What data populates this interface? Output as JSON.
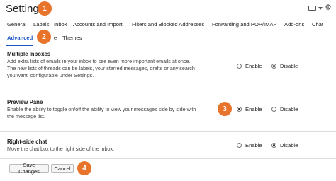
{
  "page": {
    "title": "Settings"
  },
  "annotations": [
    "1",
    "2",
    "3",
    "4"
  ],
  "tabs": {
    "row1": [
      "General",
      "Labels",
      "Inbox",
      "Accounts and Import",
      "Filters and Blocked Addresses",
      "Forwarding and POP/IMAP",
      "Add-ons",
      "Chat"
    ],
    "row2": {
      "active": "Advanced",
      "partial": "e",
      "other": "Themes"
    }
  },
  "sections": [
    {
      "title": "Multiple Inboxes",
      "description": [
        "Add extra lists of emails in your inbox to see even more important emails at once.",
        "The new lists of threads can be labels, your starred messages, drafts or any search",
        "you want, configurable under Settings."
      ],
      "enable_label": "Enable",
      "disable_label": "Disable",
      "selected": "Disable"
    },
    {
      "title": "Preview Pane",
      "description": [
        "Enable the ability to toggle on/off the ability to view your messages side by side with",
        "the message list."
      ],
      "enable_label": "Enable",
      "disable_label": "Disable",
      "selected": "Enable"
    },
    {
      "title": "Right-side chat",
      "description": [
        "Move the chat box to the right side of the inbox."
      ],
      "enable_label": "Enable",
      "disable_label": "Disable",
      "selected": "Disable"
    }
  ],
  "buttons": {
    "save": "Save Changes",
    "cancel": "Cancel"
  },
  "icons": {
    "keyboard": "keyboard-icon",
    "dropdown": "caret-down-icon",
    "settings": "gear-icon"
  },
  "colors": {
    "badge": "#e8742b",
    "active_tab": "#1a55c7"
  }
}
